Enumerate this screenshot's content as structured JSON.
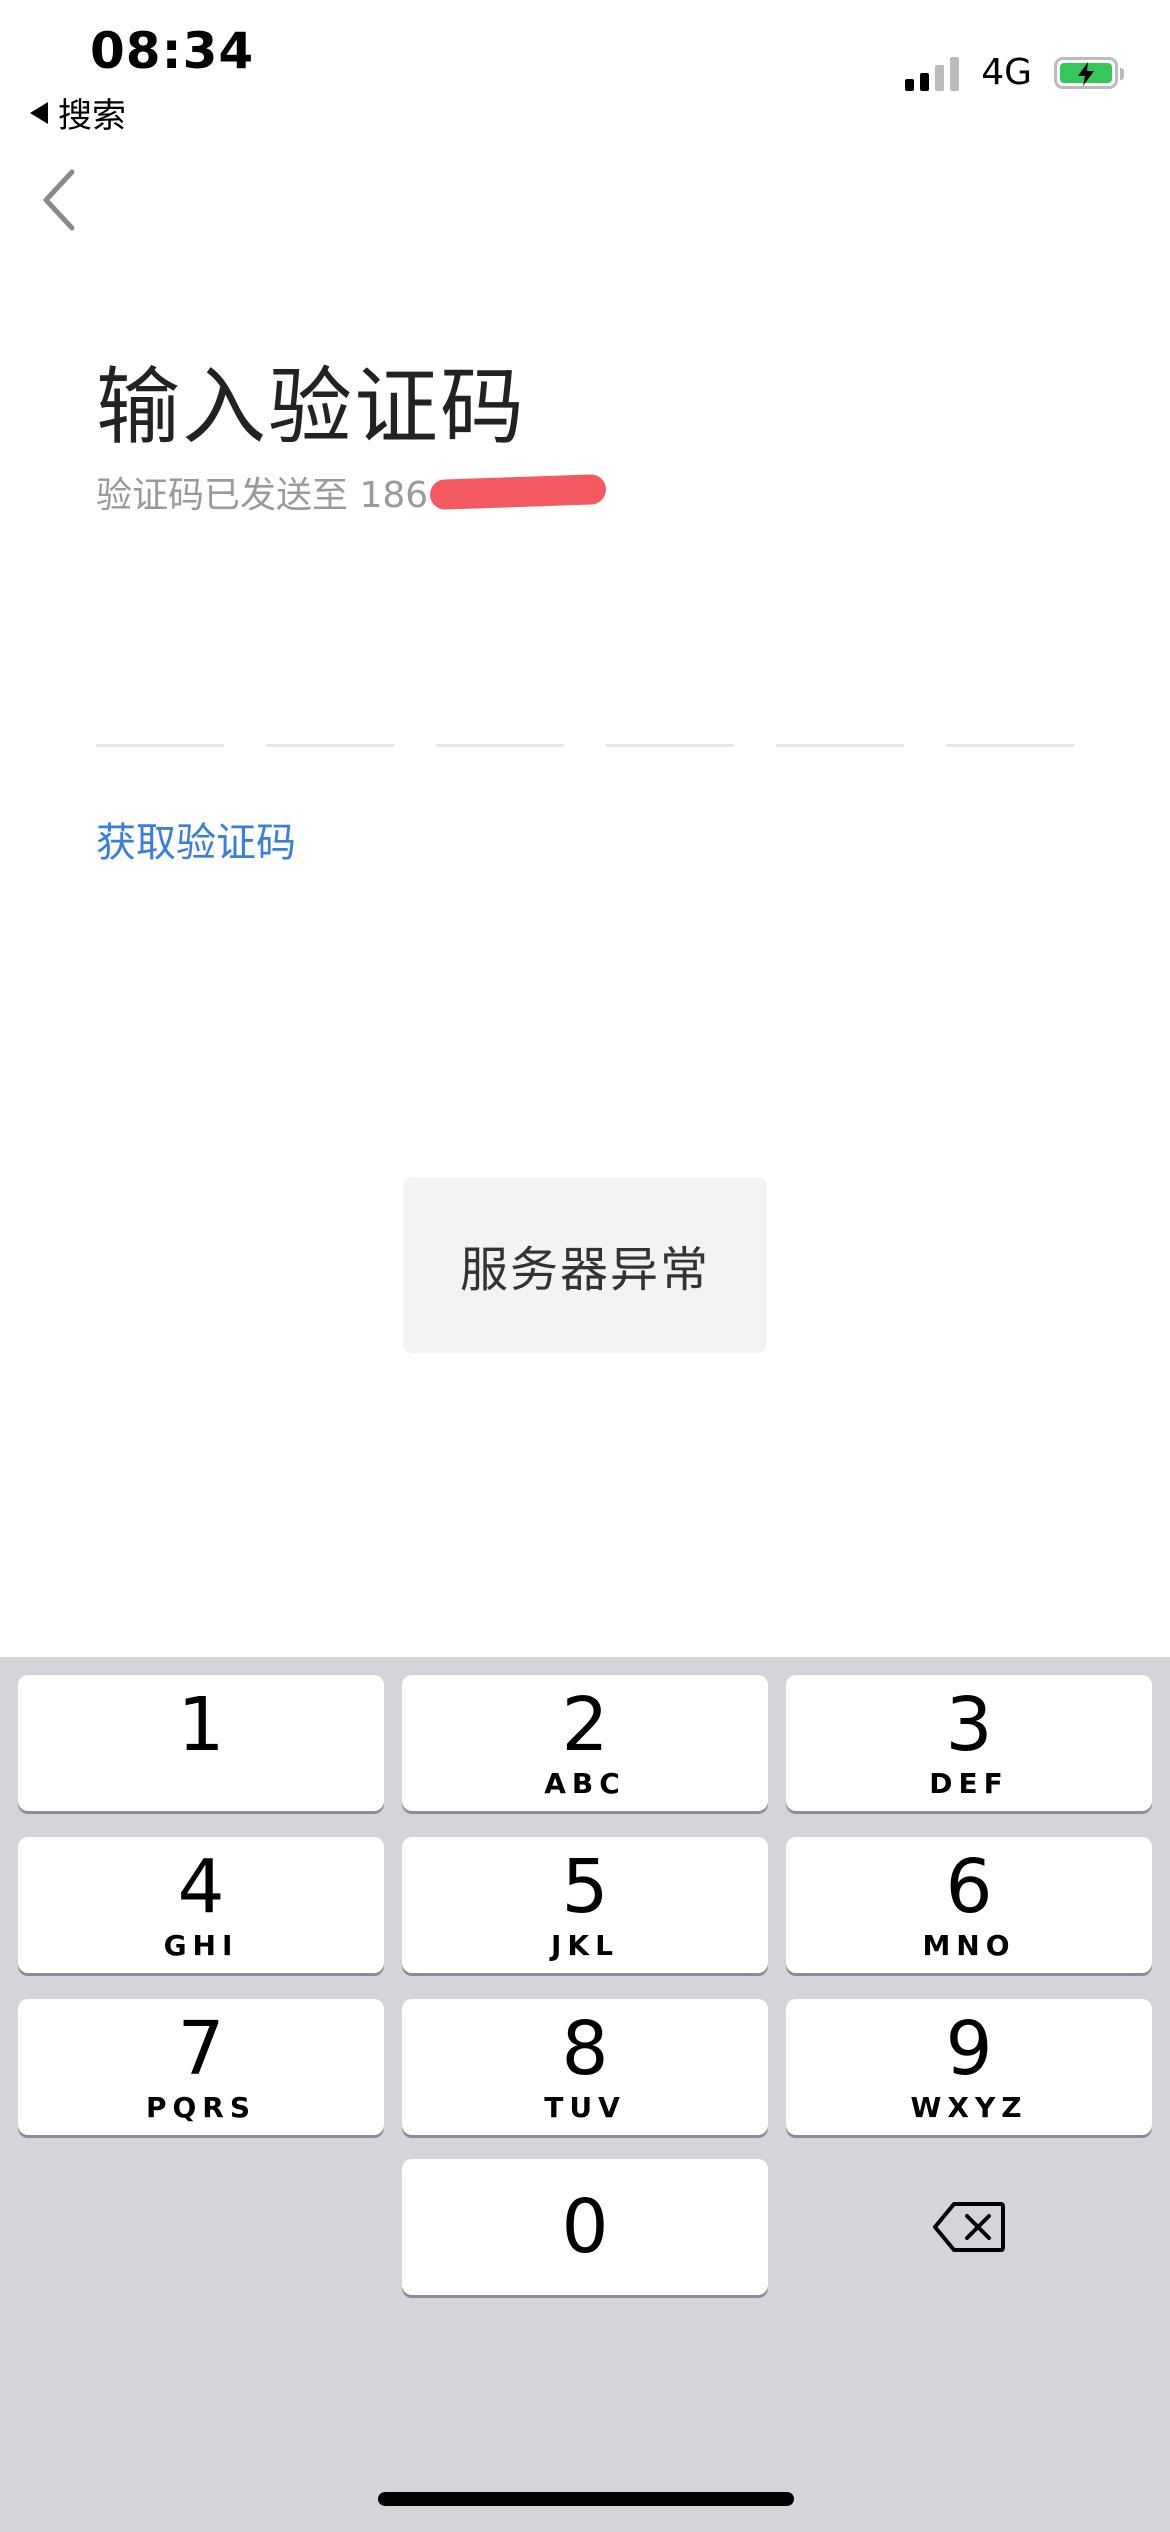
{
  "status_bar": {
    "time": "08:34",
    "back_app": "搜索",
    "network": "4G"
  },
  "header": {
    "title": "输入验证码",
    "subtitle_prefix": "验证码已发送至 186"
  },
  "code_input": {
    "length": 6
  },
  "resend": {
    "label": "获取验证码"
  },
  "toast": {
    "message": "服务器异常"
  },
  "keypad": {
    "keys": [
      {
        "num": "1",
        "letters": ""
      },
      {
        "num": "2",
        "letters": "ABC"
      },
      {
        "num": "3",
        "letters": "DEF"
      },
      {
        "num": "4",
        "letters": "GHI"
      },
      {
        "num": "5",
        "letters": "JKL"
      },
      {
        "num": "6",
        "letters": "MNO"
      },
      {
        "num": "7",
        "letters": "PQRS"
      },
      {
        "num": "8",
        "letters": "TUV"
      },
      {
        "num": "9",
        "letters": "WXYZ"
      },
      {
        "num": "0",
        "letters": ""
      }
    ]
  },
  "colors": {
    "accent": "#3a7edb",
    "keyboard_bg": "#d3d5da",
    "redaction": "#f45a5f",
    "battery": "#34c759"
  }
}
